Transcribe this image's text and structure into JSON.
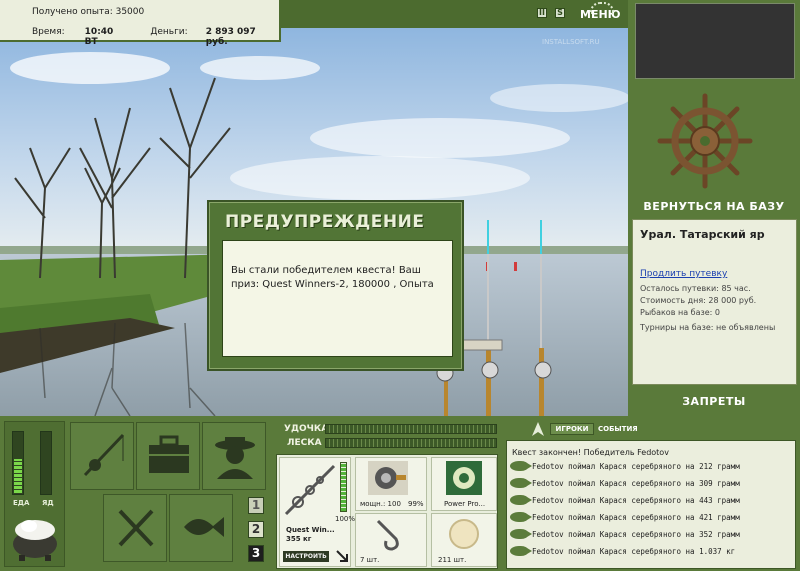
{
  "top_info": {
    "exp_label": "Получено опыта: 35000",
    "time_label": "Время:",
    "time_value": "10:40 ВТ",
    "money_label": "Деньги:",
    "money_value": "2 893 097 руб."
  },
  "top_controls": {
    "pause": "II",
    "speed": "S",
    "menu": "МЕНЮ"
  },
  "watermark": "INSTALLSOFT.RU",
  "right_panel": {
    "return_label": "ВЕРНУТЬСЯ НА БАЗУ",
    "location": "Урал. Татарский яр",
    "extend_link": "Продлить путевку",
    "trip_left": "Осталось путевки: 85 час.",
    "day_cost": "Стоимость дня: 28 000 руб.",
    "fishers": "Рыбаков на базе: 0",
    "tournaments": "Турниры на базе: не объявлены",
    "bans_label": "ЗАПРЕТЫ"
  },
  "dialog": {
    "title": "ПРЕДУПРЕЖДЕНИЕ",
    "message": "Вы стали победителем квеста! Ваш приз: Quest Winners-2, 180000 , Опыта"
  },
  "status": {
    "food_label": "ЕДА",
    "poison_label": "ЯД",
    "food_level": 0.55,
    "poison_level": 0.0
  },
  "page_buttons": [
    "1",
    "2",
    "3"
  ],
  "tackle": {
    "rod_label": "УДОЧКА",
    "line_label": "ЛЕСКА",
    "rod_name": "Quest Win...",
    "rod_weight": "355 кг",
    "rod_condition": "100%",
    "reel_power": "мощн.: 100",
    "reel_condition": "99%",
    "line_name": "Power Pro...",
    "hooks_count": "7 шт.",
    "bait_count": "211 шт.",
    "setup_button": "НАСТРОИТЬ"
  },
  "chat": {
    "tab_players": "ИГРОКИ",
    "tab_events": "СОБЫТИЯ",
    "winner": "Квест закончен! Победитель Fedotov",
    "lines": [
      "Fedotov поймал Карася серебряного на 212 грамм",
      "Fedotov поймал Карася серебряного на 309 грамм",
      "Fedotov поймал Карася серебряного на 443 грамм",
      "Fedotov поймал Карася серебряного на 421 грамм",
      "Fedotov поймал Карася серебряного на 352 грамм",
      "Fedotov поймал Карася серебряного на 1.037 кг"
    ]
  },
  "colors": {
    "panel_green": "#5a7a3a",
    "dialog_green": "#527536",
    "cream": "#ebeedd",
    "link_blue": "#1a3fb0"
  }
}
